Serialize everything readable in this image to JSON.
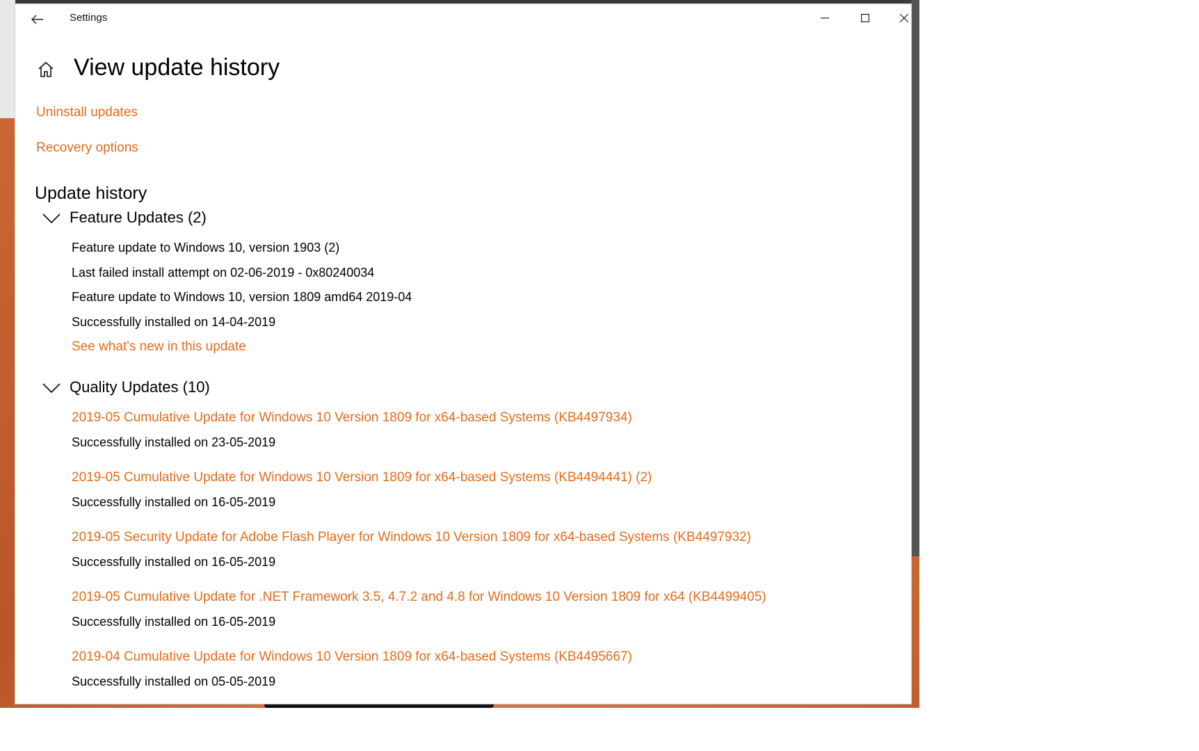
{
  "window": {
    "app_title": "Settings"
  },
  "page": {
    "title": "View update history"
  },
  "links": {
    "uninstall": "Uninstall updates",
    "recovery": "Recovery options"
  },
  "history": {
    "title": "Update history",
    "feature": {
      "header": "Feature Updates (2)",
      "items": [
        "Feature update to Windows 10, version 1903 (2)",
        "Last failed install attempt on 02-06-2019 - 0x80240034",
        "Feature update to Windows 10, version 1809 amd64 2019-04",
        "Successfully installed on 14-04-2019"
      ],
      "link": "See what's new in this update"
    },
    "quality": {
      "header": "Quality Updates (10)",
      "items": [
        {
          "title": "2019-05 Cumulative Update for Windows 10 Version 1809 for x64-based Systems (KB4497934)",
          "status": "Successfully installed on 23-05-2019"
        },
        {
          "title": "2019-05 Cumulative Update for Windows 10 Version 1809 for x64-based Systems (KB4494441) (2)",
          "status": "Successfully installed on 16-05-2019"
        },
        {
          "title": "2019-05 Security Update for Adobe Flash Player for Windows 10 Version 1809 for x64-based Systems (KB4497932)",
          "status": "Successfully installed on 16-05-2019"
        },
        {
          "title": "2019-05 Cumulative Update for .NET Framework 3.5, 4.7.2 and 4.8 for Windows 10 Version 1809 for x64 (KB4499405)",
          "status": "Successfully installed on 16-05-2019"
        },
        {
          "title": "2019-04 Cumulative Update for Windows 10 Version 1809 for x64-based Systems (KB4495667)",
          "status": "Successfully installed on 05-05-2019"
        }
      ]
    }
  },
  "colors": {
    "accent": "#e36c1c",
    "text": "#000000",
    "background": "#ffffff"
  },
  "icons": [
    "back-arrow-icon",
    "minimize-icon",
    "maximize-icon",
    "close-icon",
    "home-icon",
    "chevron-down-icon"
  ]
}
